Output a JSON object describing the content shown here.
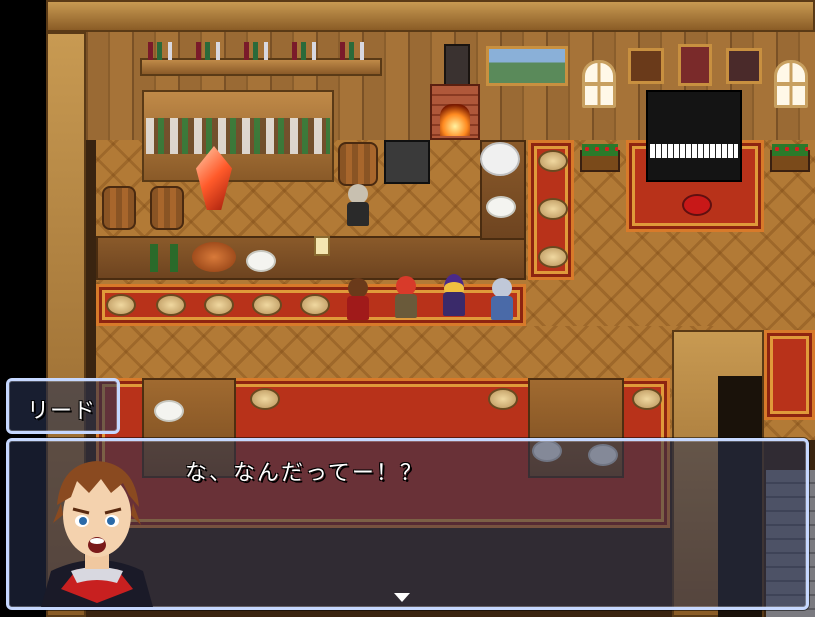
{
  "dialogue": {
    "speaker": "リード",
    "message": "な、なんだってー！？"
  },
  "colors": {
    "window_border": "#c6d8ff",
    "window_fill": "#283250",
    "carpet": "#b8321a",
    "floor": "#b27a36"
  },
  "icons": {
    "next": "advance-arrow-icon"
  }
}
